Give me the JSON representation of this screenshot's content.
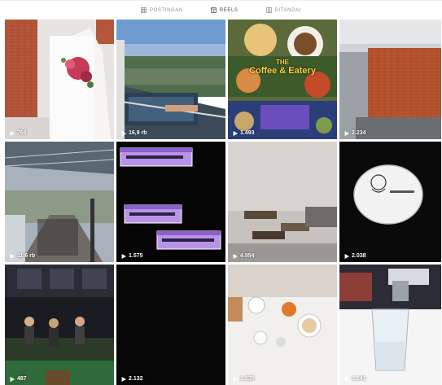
{
  "tabs": [
    {
      "label": "POSTINGAN",
      "icon": "grid-icon",
      "active": false
    },
    {
      "label": "REELS",
      "icon": "reels-icon",
      "active": true
    },
    {
      "label": "DITANDAI",
      "icon": "tag-icon",
      "active": false
    }
  ],
  "tiles": [
    {
      "views": "768"
    },
    {
      "views": "16,9 rb"
    },
    {
      "views": "1.493",
      "title_line1": "THE",
      "title_line2": "Coffee & Eatery"
    },
    {
      "views": "2.234"
    },
    {
      "views": "11,6 rb"
    },
    {
      "views": "1.575"
    },
    {
      "views": "4.954"
    },
    {
      "views": "2.038"
    },
    {
      "views": "487"
    },
    {
      "views": "2.132"
    },
    {
      "views": "1.535"
    },
    {
      "views": "3.141"
    }
  ],
  "colors": {
    "accent_purple": "#9b6bd6",
    "overlay_text": "#ffffff",
    "tab_inactive": "#8e8e8e"
  }
}
